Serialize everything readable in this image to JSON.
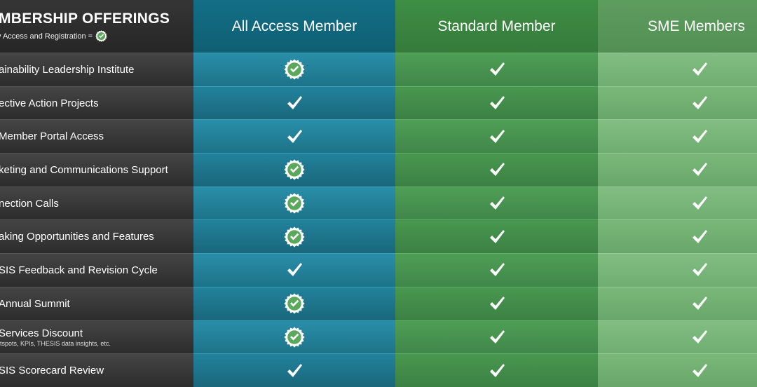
{
  "header": {
    "title": "MBERSHIP OFFERINGS",
    "subtitle": "y Access and Registration =",
    "columns": [
      "All Access Member",
      "Standard Member",
      "SME Members"
    ]
  },
  "rows": [
    {
      "label": "ainability Leadership Institute",
      "sub": "",
      "all_access": "badge",
      "standard": "check",
      "sme": "check"
    },
    {
      "label": "ective Action Projects",
      "sub": "",
      "all_access": "check",
      "standard": "check",
      "sme": "check"
    },
    {
      "label": " Member Portal Access",
      "sub": "",
      "all_access": "check",
      "standard": "check",
      "sme": "check"
    },
    {
      "label": "keting and Communications Support",
      "sub": "",
      "all_access": "badge",
      "standard": "check",
      "sme": "check"
    },
    {
      "label": "nection Calls",
      "sub": "",
      "all_access": "badge",
      "standard": "check",
      "sme": "check"
    },
    {
      "label": "aking Opportunities and Features",
      "sub": "",
      "all_access": "badge",
      "standard": "check",
      "sme": "check"
    },
    {
      "label": "SIS Feedback and Revision Cycle",
      "sub": "",
      "all_access": "check",
      "standard": "check",
      "sme": "check"
    },
    {
      "label": " Annual Summit",
      "sub": "",
      "all_access": "badge",
      "standard": "check",
      "sme": "check"
    },
    {
      "label": " Services Discount",
      "sub": "tspots, KPIs, THESIS data insights, etc.",
      "all_access": "badge",
      "standard": "check",
      "sme": "check"
    },
    {
      "label": "SIS Scorecard Review",
      "sub": "",
      "all_access": "check",
      "standard": "check",
      "sme": "check"
    }
  ],
  "icons": {
    "check": "check-icon",
    "badge": "certified-badge-icon"
  },
  "colors": {
    "all_access": "#1c7389",
    "standard": "#40874a",
    "sme": "#6fad70",
    "badge_fill": "#5aa85c"
  }
}
